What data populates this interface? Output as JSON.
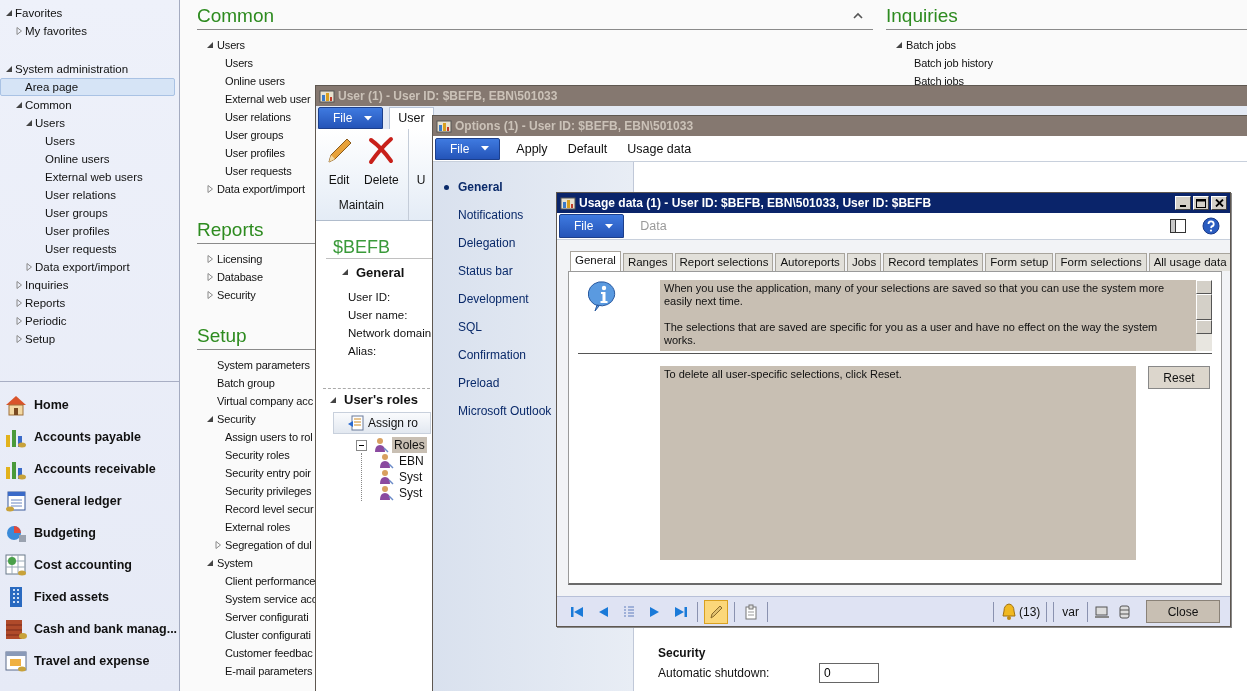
{
  "navigation_pane": {
    "tree": [
      {
        "label": "Favorites",
        "expanded": true,
        "selected": false,
        "children": [
          {
            "label": "My favorites",
            "expanded": false,
            "selected": false
          }
        ]
      },
      {
        "label": "System administration",
        "expanded": true,
        "selected": false,
        "children": [
          {
            "label": "Area page",
            "selected": true
          },
          {
            "label": "Common",
            "expanded": true,
            "selected": false,
            "children": [
              {
                "label": "Users",
                "expanded": true,
                "selected": false,
                "children": [
                  {
                    "label": "Users",
                    "selected": false
                  },
                  {
                    "label": "Online users",
                    "selected": false
                  },
                  {
                    "label": "External web users",
                    "selected": false
                  },
                  {
                    "label": "User relations",
                    "selected": false
                  },
                  {
                    "label": "User groups",
                    "selected": false
                  },
                  {
                    "label": "User profiles",
                    "selected": false
                  },
                  {
                    "label": "User requests",
                    "selected": false
                  }
                ]
              },
              {
                "label": "Data export/import",
                "expanded": false,
                "selected": false
              }
            ]
          },
          {
            "label": "Inquiries",
            "expanded": false,
            "selected": false
          },
          {
            "label": "Reports",
            "expanded": false,
            "selected": false
          },
          {
            "label": "Periodic",
            "expanded": false,
            "selected": false
          },
          {
            "label": "Setup",
            "expanded": false,
            "selected": false
          }
        ]
      }
    ],
    "modules": [
      {
        "label": "Home",
        "kind": "house"
      },
      {
        "label": "Accounts payable",
        "kind": "chart"
      },
      {
        "label": "Accounts receivable",
        "kind": "chart"
      },
      {
        "label": "General ledger",
        "kind": "ledger"
      },
      {
        "label": "Budgeting",
        "kind": "pie"
      },
      {
        "label": "Cost accounting",
        "kind": "sheet"
      },
      {
        "label": "Fixed assets",
        "kind": "tower"
      },
      {
        "label": "Cash and bank manag...",
        "kind": "brick"
      },
      {
        "label": "Travel and expense",
        "kind": "calendar"
      }
    ]
  },
  "area_page": {
    "columns": [
      [
        {
          "title": "Common",
          "collapsible": true,
          "items": [
            {
              "label": "Users",
              "expanded": true,
              "children": [
                {
                  "label": "Users"
                },
                {
                  "label": "Online users"
                },
                {
                  "label": "External web user"
                },
                {
                  "label": "User relations"
                },
                {
                  "label": "User groups"
                },
                {
                  "label": "User profiles"
                },
                {
                  "label": "User requests"
                }
              ]
            },
            {
              "label": "Data export/import",
              "expanded": false
            }
          ]
        },
        {
          "title": "Reports",
          "items": [
            {
              "label": "Licensing",
              "expanded": false
            },
            {
              "label": "Database",
              "expanded": false
            },
            {
              "label": "Security",
              "expanded": false
            }
          ]
        },
        {
          "title": "Setup",
          "items": [
            {
              "label": "System parameters"
            },
            {
              "label": "Batch group"
            },
            {
              "label": "Virtual company acc"
            },
            {
              "label": "Security",
              "expanded": true,
              "children": [
                {
                  "label": "Assign users to rol"
                },
                {
                  "label": "Security roles"
                },
                {
                  "label": "Security entry poir"
                },
                {
                  "label": "Security privileges"
                },
                {
                  "label": "Record level secur"
                },
                {
                  "label": "External roles"
                },
                {
                  "label": "Segregation of dul",
                  "expanded": false
                }
              ]
            },
            {
              "label": "System",
              "expanded": true,
              "children": [
                {
                  "label": "Client performance"
                },
                {
                  "label": "System service acc"
                },
                {
                  "label": "Server configurati"
                },
                {
                  "label": "Cluster configurati"
                },
                {
                  "label": "Customer feedbac"
                },
                {
                  "label": "E-mail parameters"
                }
              ]
            }
          ]
        }
      ],
      [
        {
          "title": "Inquiries",
          "items": [
            {
              "label": "Batch jobs",
              "expanded": true,
              "children": [
                {
                  "label": "Batch job history"
                },
                {
                  "label": "Batch jobs"
                }
              ]
            }
          ]
        }
      ]
    ]
  },
  "windows": [
    {
      "kind": "user",
      "title": "User (1) - User ID: $BEFB, EBN\\501033",
      "active": false,
      "ribbon": {
        "file": "File",
        "tabs": [
          {
            "label": "User",
            "selected": true
          }
        ],
        "groups": [
          {
            "label": "Maintain",
            "buttons": [
              {
                "label": "Edit",
                "kind": "pencil"
              },
              {
                "label": "Delete",
                "kind": "cross"
              }
            ]
          },
          {
            "buttons": [
              {
                "label": "U",
                "kind": "blank"
              }
            ]
          }
        ]
      },
      "record_title": "$BEFB",
      "general": {
        "title": "General",
        "expanded": true,
        "fields": [
          "User ID:",
          "User name:",
          "Network domain:",
          "Alias:"
        ]
      },
      "roles": {
        "title": "User's roles",
        "expanded": true,
        "assign_button": "Assign ro",
        "tree": {
          "label": "Roles",
          "expanded": true,
          "selected": true,
          "children": [
            {
              "label": "EBN",
              "selected": false
            },
            {
              "label": "Syst",
              "selected": false
            },
            {
              "label": "Syst",
              "selected": false
            }
          ]
        }
      }
    },
    {
      "kind": "options",
      "title": "Options (1) - User ID: $BEFB, EBN\\501033",
      "active": false,
      "menu": {
        "file": "File",
        "items": [
          "Apply",
          "Default",
          "Usage data"
        ]
      },
      "pages": [
        {
          "label": "General",
          "selected": true
        },
        {
          "label": "Notifications",
          "selected": false
        },
        {
          "label": "Delegation",
          "selected": false
        },
        {
          "label": "Status bar",
          "selected": false
        },
        {
          "label": "Development",
          "selected": false
        },
        {
          "label": "SQL",
          "selected": false
        },
        {
          "label": "Confirmation",
          "selected": false
        },
        {
          "label": "Preload",
          "selected": false
        },
        {
          "label": "Microsoft Outlook",
          "selected": false
        }
      ],
      "security": {
        "title": "Security",
        "fields": [
          {
            "label": "Automatic shutdown:",
            "value": "0"
          }
        ]
      }
    },
    {
      "kind": "usage",
      "title": "Usage data (1) - User ID: $BEFB, EBN\\501033, User ID: $BEFB",
      "active": true,
      "menu": {
        "file": "File",
        "items": [
          {
            "label": "Data",
            "disabled": true
          }
        ]
      },
      "tabs": [
        {
          "label": "General",
          "selected": true
        },
        {
          "label": "Ranges",
          "selected": false
        },
        {
          "label": "Report selections",
          "selected": false
        },
        {
          "label": "Autoreports",
          "selected": false
        },
        {
          "label": "Jobs",
          "selected": false
        },
        {
          "label": "Record templates",
          "selected": false
        },
        {
          "label": "Form setup",
          "selected": false
        },
        {
          "label": "Form selections",
          "selected": false
        },
        {
          "label": "All usage data",
          "selected": false
        }
      ],
      "info_paragraphs": [
        "When you use the application, many of your selections are saved so that you can use the system more easily next time.",
        "The selections that are saved are specific for you as a user and have no effect on the way the system works."
      ],
      "reset_text": "To delete all user-specific selections, click Reset.",
      "reset_button": "Reset",
      "toolbar": {
        "tools": [
          {
            "kind": "edit",
            "on": true
          },
          {
            "kind": "attachment",
            "on": false
          }
        ]
      },
      "notifications": "(13)",
      "company": "var",
      "close_button": "Close"
    }
  ]
}
